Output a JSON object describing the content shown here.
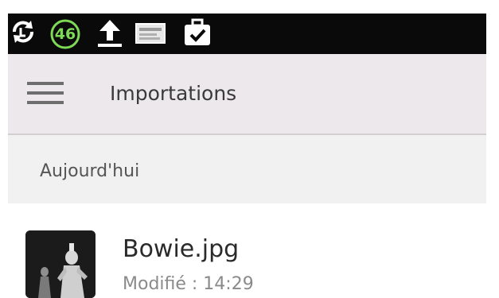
{
  "status_bar": {
    "icons": [
      "sync-icon",
      "battery-badge-icon",
      "upload-icon",
      "card-icon",
      "briefcase-check-icon"
    ],
    "badge_value": "46",
    "colors": {
      "background": "#0a0a0a",
      "badge": "#7ed957"
    }
  },
  "toolbar": {
    "title": "Importations",
    "menu_icon": "hamburger-menu-icon",
    "background": "#ece8eb"
  },
  "section": {
    "label": "Aujourd'hui"
  },
  "files": [
    {
      "name": "Bowie.jpg",
      "modified": "Modifié : 14:29",
      "thumbnail_icon": "image-thumbnail-icon"
    }
  ]
}
